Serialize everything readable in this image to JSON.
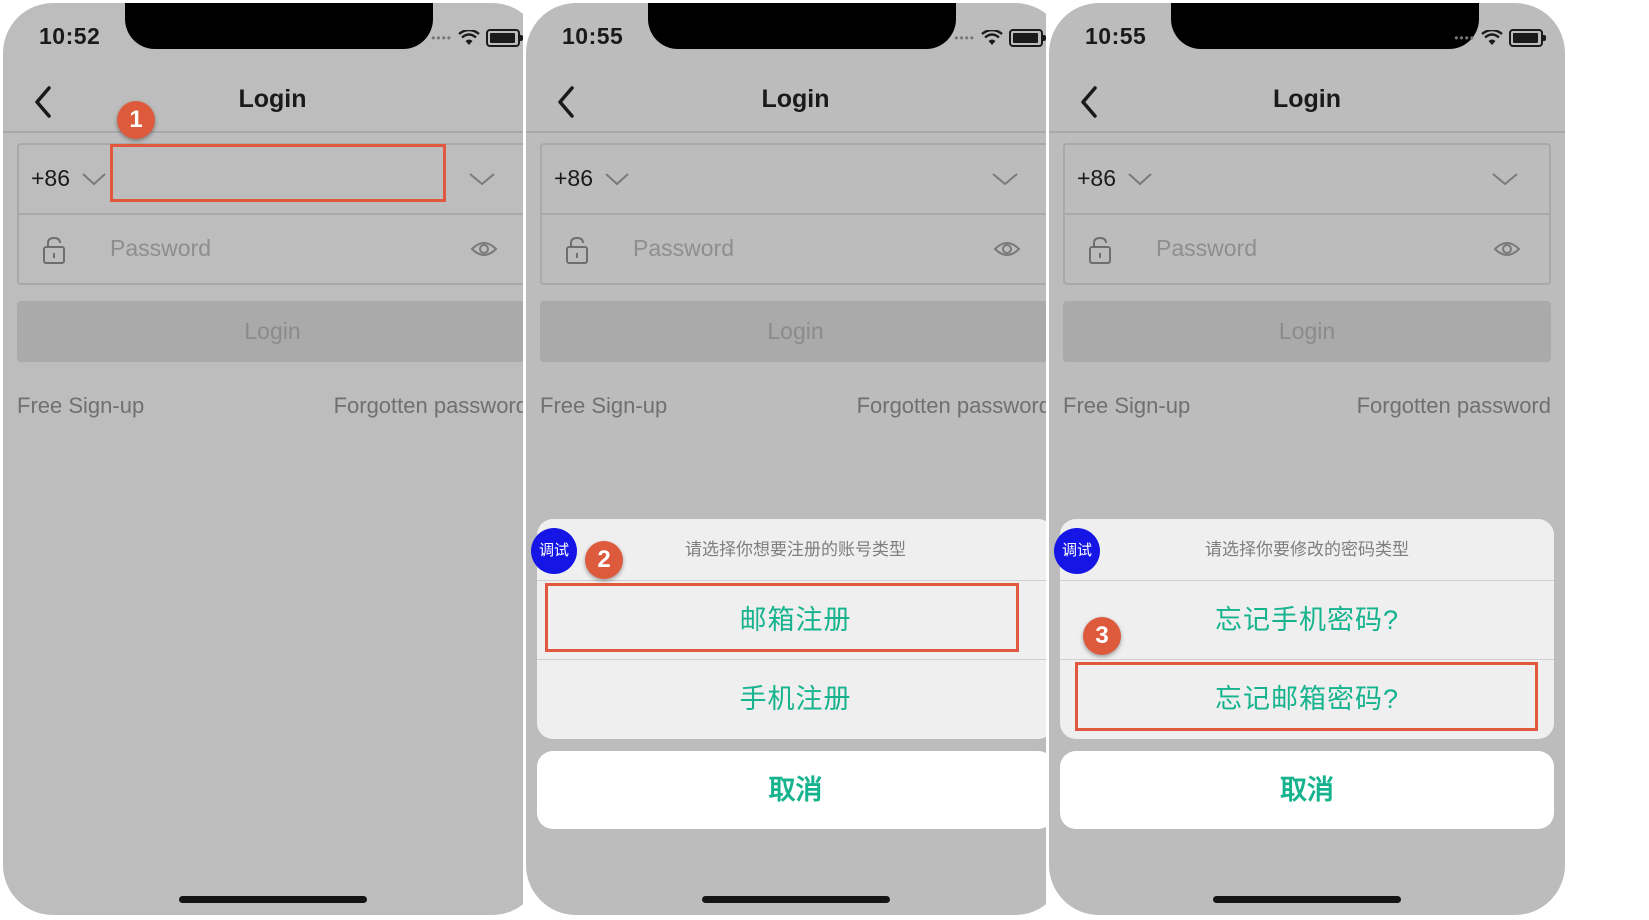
{
  "screens": [
    {
      "time": "10:52",
      "nav_title": "Login",
      "country_code": "+86",
      "password_placeholder": "Password",
      "login_button": "Login",
      "signup_link": "Free Sign-up",
      "forgot_link": "Forgotten password",
      "step_number": "1"
    },
    {
      "time": "10:55",
      "nav_title": "Login",
      "country_code": "+86",
      "password_placeholder": "Password",
      "login_button": "Login",
      "signup_link": "Free Sign-up",
      "forgot_link": "Forgotten password",
      "step_number": "2",
      "debug_badge": "调试",
      "sheet": {
        "title": "请选择你想要注册的账号类型",
        "options": [
          "邮箱注册",
          "手机注册"
        ],
        "cancel": "取消"
      }
    },
    {
      "time": "10:55",
      "nav_title": "Login",
      "country_code": "+86",
      "password_placeholder": "Password",
      "login_button": "Login",
      "signup_link": "Free Sign-up",
      "forgot_link": "Forgotten password",
      "step_number": "3",
      "debug_badge": "调试",
      "sheet": {
        "title": "请选择你要修改的密码类型",
        "options": [
          "忘记手机密码?",
          "忘记邮箱密码?"
        ],
        "cancel": "取消"
      }
    }
  ],
  "colors": {
    "accent_green": "#16b38e",
    "annotation_red": "#e2583e",
    "debug_blue": "#1515e6",
    "overlay_gray": "#bcbcbc"
  },
  "icons": [
    "back-chevron-icon",
    "chevron-down-icon",
    "lock-icon",
    "eye-icon",
    "wifi-icon",
    "battery-icon"
  ]
}
